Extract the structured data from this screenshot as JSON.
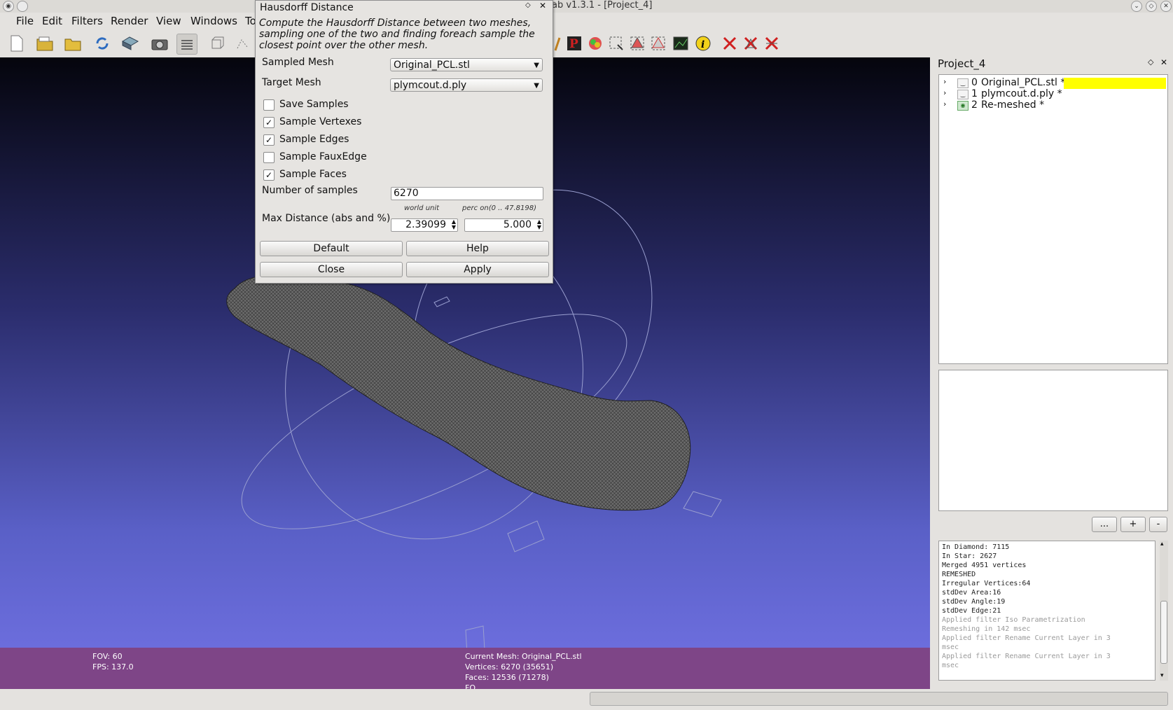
{
  "window": {
    "title": "ab v1.3.1 - [Project_4]"
  },
  "menu": [
    "File",
    "Edit",
    "Filters",
    "Render",
    "View",
    "Windows",
    "To"
  ],
  "dialog": {
    "title": "Hausdorff Distance",
    "description": "Compute the Hausdorff Distance between two meshes, sampling one of the two and finding foreach sample the closest point over the other mesh.",
    "sampled_mesh_label": "Sampled Mesh",
    "sampled_mesh_value": "Original_PCL.stl",
    "target_mesh_label": "Target Mesh",
    "target_mesh_value": "plymcout.d.ply",
    "checkboxes": [
      {
        "label": "Save Samples",
        "checked": false
      },
      {
        "label": "Sample Vertexes",
        "checked": true
      },
      {
        "label": "Sample Edges",
        "checked": true
      },
      {
        "label": "Sample FauxEdge",
        "checked": false
      },
      {
        "label": "Sample Faces",
        "checked": true
      }
    ],
    "samples_label": "Number of samples",
    "samples_value": "6270",
    "world_unit_label": "world unit",
    "perc_label": "perc on(0 .. 47.8198)",
    "max_distance_label": "Max Distance (abs and %)",
    "max_distance_abs": "2.39099",
    "max_distance_perc": "5.000",
    "buttons": {
      "default": "Default",
      "help": "Help",
      "close": "Close",
      "apply": "Apply"
    }
  },
  "viewport_info": {
    "fov": "FOV: 60",
    "fps": "FPS:   137.0",
    "current_mesh": "Current Mesh: Original_PCL.stl",
    "vertices": "Vertices: 6270 (35651)",
    "faces": "Faces: 12536 (71278)",
    "fo": "FO"
  },
  "project": {
    "title": "Project_4",
    "layers": [
      {
        "index": "0",
        "name": "Original_PCL.stl *",
        "selected": true
      },
      {
        "index": "1",
        "name": "plymcout.d.ply *",
        "selected": false
      },
      {
        "index": "2",
        "name": "Re-meshed *",
        "selected": false
      }
    ],
    "buttons": {
      "more": "...",
      "add": "+",
      "remove": "-"
    }
  },
  "log": [
    {
      "text": "In Diamond: 7115",
      "dim": false
    },
    {
      "text": "In Star: 2627",
      "dim": false
    },
    {
      "text": "Merged 4951 vertices",
      "dim": false
    },
    {
      "text": "REMESHED",
      "dim": false
    },
    {
      "text": "Irregular Vertices:64",
      "dim": false
    },
    {
      "text": "stdDev Area:16",
      "dim": false
    },
    {
      "text": "stdDev Angle:19",
      "dim": false
    },
    {
      "text": "stdDev Edge:21",
      "dim": false
    },
    {
      "text": "Applied filter Iso Parametrization",
      "dim": true
    },
    {
      "text": "Remeshing in 142 msec",
      "dim": true
    },
    {
      "text": "Applied filter Rename Current Layer in 3",
      "dim": true
    },
    {
      "text": "msec",
      "dim": true
    },
    {
      "text": "Applied filter Rename Current Layer in 3",
      "dim": true
    },
    {
      "text": "msec",
      "dim": true
    }
  ],
  "colors": {
    "selection": "#ffff00",
    "info_band": "#7e4587"
  }
}
